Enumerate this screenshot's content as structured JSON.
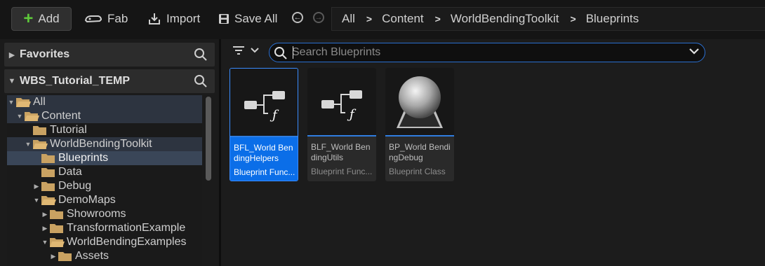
{
  "toolbar": {
    "add_label": "Add",
    "fab_label": "Fab",
    "import_label": "Import",
    "save_all_label": "Save All"
  },
  "breadcrumb": [
    "All",
    "Content",
    "WorldBendingToolkit",
    "Blueprints"
  ],
  "sidebar": {
    "favorites_label": "Favorites",
    "project_label": "WBS_Tutorial_TEMP",
    "tree": [
      {
        "label": "All",
        "level": 0,
        "caret": "open",
        "state": "highlight"
      },
      {
        "label": "Content",
        "level": 1,
        "caret": "open",
        "state": "highlight"
      },
      {
        "label": "Tutorial",
        "level": 2,
        "caret": "none",
        "state": ""
      },
      {
        "label": "WorldBendingToolkit",
        "level": 2,
        "caret": "open",
        "state": "highlight"
      },
      {
        "label": "Blueprints",
        "level": 3,
        "caret": "none",
        "state": "selected"
      },
      {
        "label": "Data",
        "level": 3,
        "caret": "none",
        "state": ""
      },
      {
        "label": "Debug",
        "level": 3,
        "caret": "closed",
        "state": ""
      },
      {
        "label": "DemoMaps",
        "level": 3,
        "caret": "open",
        "state": ""
      },
      {
        "label": "Showrooms",
        "level": 4,
        "caret": "closed",
        "state": ""
      },
      {
        "label": "TransformationExample",
        "level": 4,
        "caret": "closed",
        "state": ""
      },
      {
        "label": "WorldBendingExamples",
        "level": 4,
        "caret": "open",
        "state": ""
      },
      {
        "label": "Assets",
        "level": 5,
        "caret": "closed",
        "state": ""
      }
    ]
  },
  "content": {
    "search_placeholder": "Search Blueprints",
    "assets": [
      {
        "name": "BFL_World BendingHelpers",
        "type": "Blueprint Func...",
        "icon": "function-library-icon",
        "selected": true
      },
      {
        "name": "BLF_World BendingUtils",
        "type": "Blueprint Func...",
        "icon": "function-library-icon",
        "selected": false
      },
      {
        "name": "BP_World BendingDebug",
        "type": "Blueprint Class",
        "icon": "sphere-icon",
        "selected": false
      }
    ]
  },
  "colors": {
    "accent": "#0b6ee8",
    "add_plus": "#5ec93a",
    "folder": "#c9a262",
    "background": "#151515"
  }
}
